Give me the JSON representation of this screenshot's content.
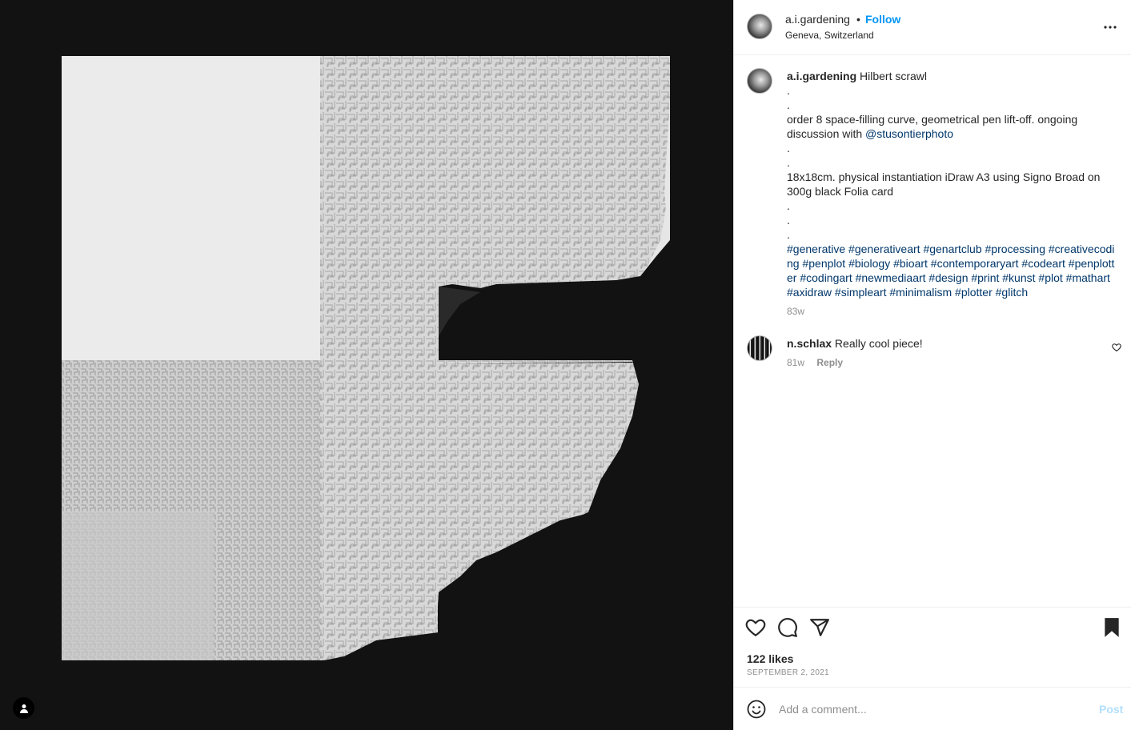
{
  "header": {
    "username": "a.i.gardening",
    "separator": "•",
    "follow_label": "Follow",
    "location": "Geneva, Switzerland"
  },
  "caption": {
    "username": "a.i.gardening",
    "title": "Hilbert scrawl",
    "line_dot_1": ".",
    "line_dot_2": ".",
    "line_1": "order 8 space-filling curve, geometrical pen lift-off. ongoing discussion with ",
    "mention": "@stusontierphoto",
    "line_dot_3": ".",
    "line_dot_4": ".",
    "line_2": "18x18cm. physical instantiation iDraw A3 using Signo Broad on 300g black Folia card",
    "line_dot_5": ".",
    "line_dot_6": ".",
    "line_dot_7": ".",
    "hashtags": "#generative #generativeart #genartclub #processing #creativecoding #penplot #biology #bioart #contemporaryart #codeart #penplotter #codingart #newmediaart #design #print #kunst #plot #mathart #axidraw #simpleart #minimalism #plotter #glitch",
    "age": "83w"
  },
  "comments": [
    {
      "username": "n.schlax",
      "text": "Really cool piece!",
      "age": "81w",
      "reply_label": "Reply"
    }
  ],
  "actions": {
    "likes": "122 likes",
    "date": "SEPTEMBER 2, 2021"
  },
  "add_comment": {
    "placeholder": "Add a comment...",
    "post_label": "Post"
  },
  "icons": {
    "header_more": "more-horizontal-icon",
    "like": "heart-icon",
    "comment": "comment-bubble-icon",
    "share": "paper-plane-icon",
    "save": "bookmark-filled-icon",
    "comment_like": "small-heart-icon",
    "emoji": "emoji-smile-icon",
    "tagged_user": "user-tag-icon"
  },
  "colors": {
    "accent": "#0095f6",
    "link": "#00376b",
    "muted": "#8e8e8e",
    "post_disabled": "#b2dffc",
    "media_bg": "#121212"
  }
}
